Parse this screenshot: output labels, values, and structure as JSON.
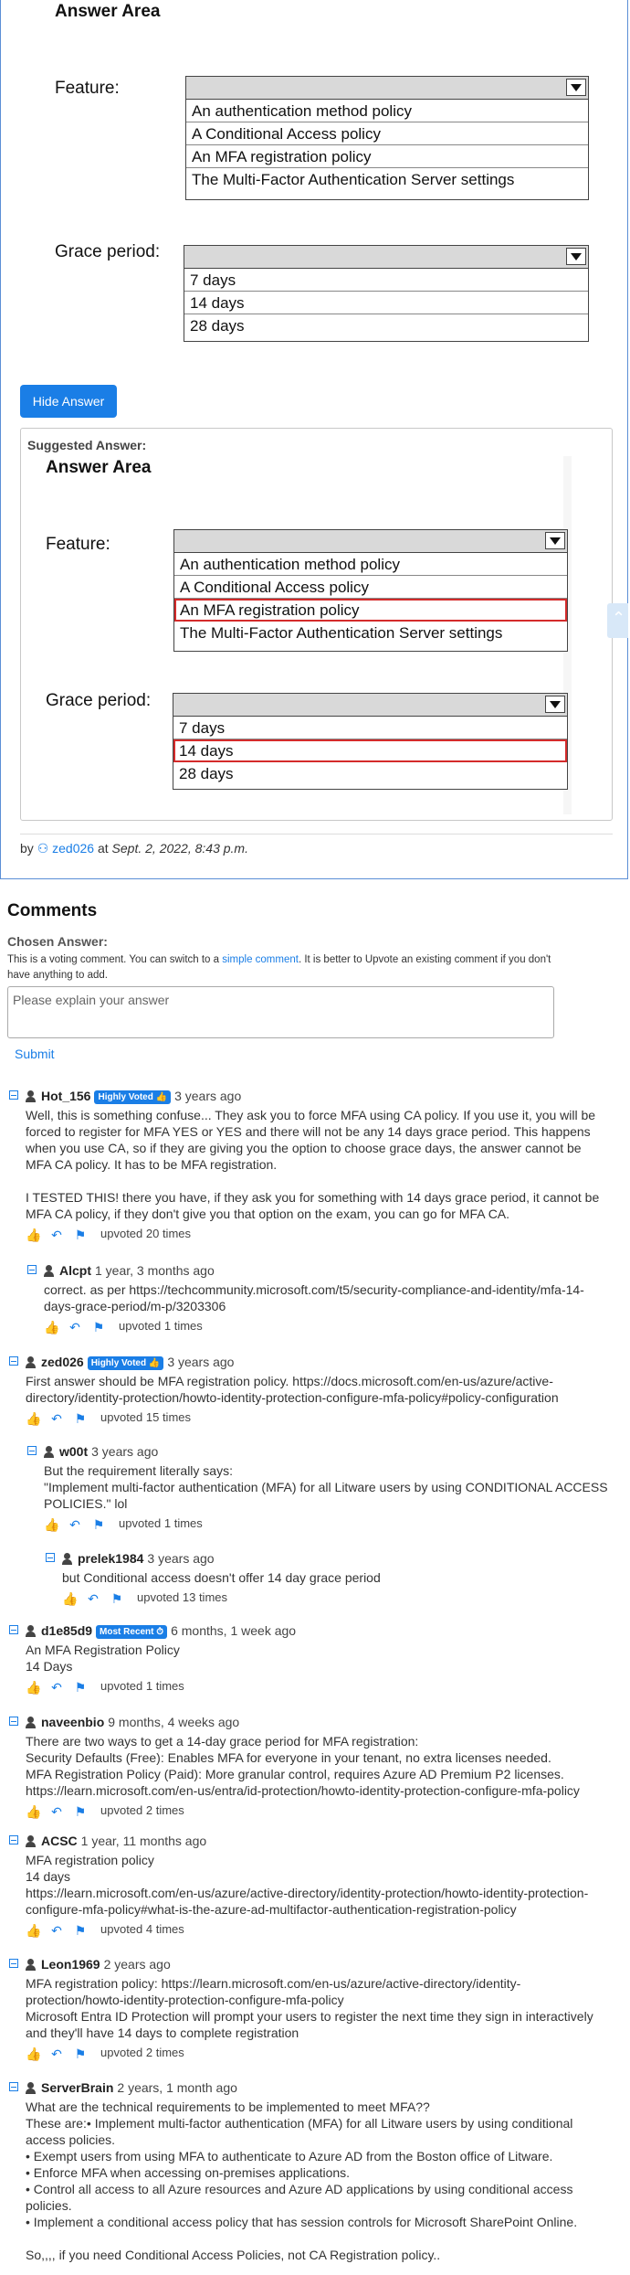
{
  "answer_area": {
    "title": "Answer Area",
    "feature_label": "Feature:",
    "feature_options": [
      "An authentication method policy",
      "A Conditional Access policy",
      "An MFA registration policy",
      "The Multi-Factor Authentication Server settings"
    ],
    "grace_label": "Grace period:",
    "grace_options": [
      "7 days",
      "14 days",
      "28 days"
    ]
  },
  "hide_button": "Hide Answer",
  "suggested": {
    "label": "Suggested Answer:",
    "title": "Answer Area",
    "feature_label": "Feature:",
    "feature_options": [
      "An authentication method policy",
      "A Conditional Access policy",
      "An MFA registration policy",
      "The Multi-Factor Authentication Server settings"
    ],
    "feature_selected_index": 2,
    "grace_label": "Grace period:",
    "grace_options": [
      "7 days",
      "14 days",
      "28 days"
    ],
    "grace_selected_index": 1
  },
  "byline": {
    "by": "by",
    "user": "zed026",
    "at": "at",
    "date": "Sept. 2, 2022, 8:43 p.m."
  },
  "comments_section": {
    "heading": "Comments",
    "chosen_answer": "Chosen Answer:",
    "note_before": "This is a voting comment. You can switch to a ",
    "note_link": "simple comment",
    "note_after": ". It is better to Upvote an existing comment if you don't have anything to add.",
    "placeholder": "Please explain your answer",
    "submit": "Submit"
  },
  "comments": [
    {
      "user": "Hot_156",
      "badge": "Highly Voted 👍",
      "when": "3 years ago",
      "body": [
        "Well, this is something confuse... They ask you to force MFA using CA policy. If you use it, you will be forced to register for MFA YES or YES and there will not be any 14 days grace period. This happens when you use CA, so if they are giving you the option to choose grace days, the answer cannot be MFA CA policy. It has to be MFA registration.",
        "",
        "I TESTED THIS! there you have, if they ask you for something with 14 days grace period, it cannot be MFA CA policy, if they don't give you that option on the exam, you can go for MFA CA."
      ],
      "upvotes": "upvoted 20 times"
    },
    {
      "user": "Alcpt",
      "badge": "",
      "when": "1 year, 3 months ago",
      "body": [
        "correct. as per https://techcommunity.microsoft.com/t5/security-compliance-and-identity/mfa-14-days-grace-period/m-p/3203306"
      ],
      "upvotes": "upvoted 1 times"
    },
    {
      "user": "zed026",
      "badge": "Highly Voted 👍",
      "when": "3 years ago",
      "body": [
        "First answer should be MFA registration policy. https://docs.microsoft.com/en-us/azure/active-directory/identity-protection/howto-identity-protection-configure-mfa-policy#policy-configuration"
      ],
      "upvotes": "upvoted 15 times"
    },
    {
      "user": "w00t",
      "badge": "",
      "when": "3 years ago",
      "body": [
        "But the requirement literally says:",
        "\"Implement multi-factor authentication (MFA) for all Litware users by using CONDITIONAL ACCESS POLICIES.\" lol"
      ],
      "upvotes": "upvoted 1 times"
    },
    {
      "user": "prelek1984",
      "badge": "",
      "when": "3 years ago",
      "body": [
        "but Conditional access doesn't offer 14 day grace period"
      ],
      "upvotes": "upvoted 13 times"
    },
    {
      "user": "d1e85d9",
      "badge": "Most Recent ⏱",
      "when": "6 months, 1 week ago",
      "body": [
        "An MFA Registration Policy",
        "14 Days"
      ],
      "upvotes": "upvoted 1 times"
    },
    {
      "user": "naveenbio",
      "badge": "",
      "when": "9 months, 4 weeks ago",
      "body": [
        "There are two ways to get a 14-day grace period for MFA registration:",
        "Security Defaults (Free): Enables MFA for everyone in your tenant, no extra licenses needed.",
        "MFA Registration Policy (Paid): More granular control, requires Azure AD Premium P2 licenses.",
        "https://learn.microsoft.com/en-us/entra/id-protection/howto-identity-protection-configure-mfa-policy"
      ],
      "upvotes": "upvoted 2 times"
    },
    {
      "user": "ACSC",
      "badge": "",
      "when": "1 year, 11 months ago",
      "body": [
        "MFA registration policy",
        "14 days",
        "https://learn.microsoft.com/en-us/azure/active-directory/identity-protection/howto-identity-protection-configure-mfa-policy#what-is-the-azure-ad-multifactor-authentication-registration-policy"
      ],
      "upvotes": "upvoted 4 times"
    },
    {
      "user": "Leon1969",
      "badge": "",
      "when": "2 years ago",
      "body": [
        "MFA registration policy: https://learn.microsoft.com/en-us/azure/active-directory/identity-protection/howto-identity-protection-configure-mfa-policy",
        "Microsoft Entra ID Protection will prompt your users to register the next time they sign in interactively and they'll have 14 days to complete registration"
      ],
      "upvotes": "upvoted 2 times"
    },
    {
      "user": "ServerBrain",
      "badge": "",
      "when": "2 years, 1 month ago",
      "body": [
        "What are the technical requirements to be implemented to meet MFA??",
        "These are:• Implement multi-factor authentication (MFA) for all Litware users by using conditional access policies.",
        "• Exempt users from using MFA to authenticate to Azure AD from the Boston office of Litware.",
        "• Enforce MFA when accessing on-premises applications.",
        "• Control all access to all Azure resources and Azure AD applications by using conditional access policies.",
        "• Implement a conditional access policy that has session controls for Microsoft SharePoint Online.",
        "",
        "So,,,, if you need Conditional Access Policies, not CA Registration policy.."
      ],
      "upvotes": ""
    }
  ]
}
